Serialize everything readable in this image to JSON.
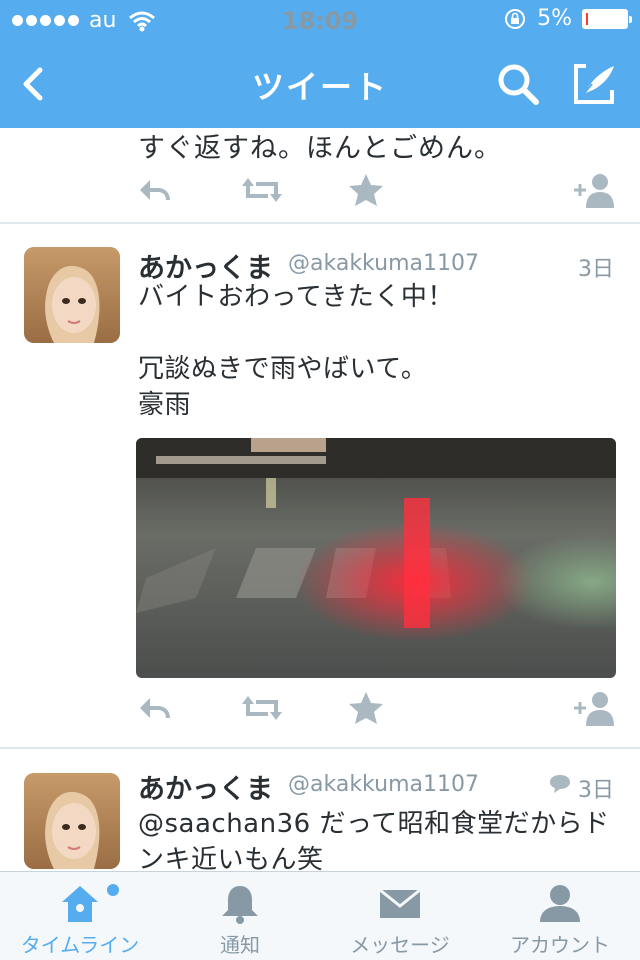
{
  "status_bar": {
    "carrier": "au",
    "time": "18:09",
    "battery": "5%",
    "battery_level": 0.05
  },
  "nav": {
    "title": "ツイート"
  },
  "timeline": {
    "partial_tweet": {
      "text": "すぐ返すね。ほんとごめん。"
    },
    "tweets": [
      {
        "name": "あかっくま",
        "handle": "@akakkuma1107",
        "time": "3日",
        "text": "バイトおわってきたく中！\n\n冗談ぬきで雨やばいて。\n豪雨",
        "has_photo": true
      },
      {
        "name": "あかっくま",
        "handle": "@akakkuma1107",
        "time": "3日",
        "text": "@saachan36 だって昭和食堂だからドンキ近いもん笑",
        "has_reply_icon": true
      }
    ]
  },
  "tabbar": {
    "tabs": [
      {
        "label": "タイムライン",
        "icon": "home-icon",
        "active": true
      },
      {
        "label": "通知",
        "icon": "bell-icon",
        "active": false
      },
      {
        "label": "メッセージ",
        "icon": "envelope-icon",
        "active": false
      },
      {
        "label": "アカウント",
        "icon": "person-icon",
        "active": false
      }
    ]
  },
  "colors": {
    "accent": "#55acee",
    "text": "#292f33",
    "muted": "#8899a6",
    "action_icon": "#aab8c2"
  }
}
